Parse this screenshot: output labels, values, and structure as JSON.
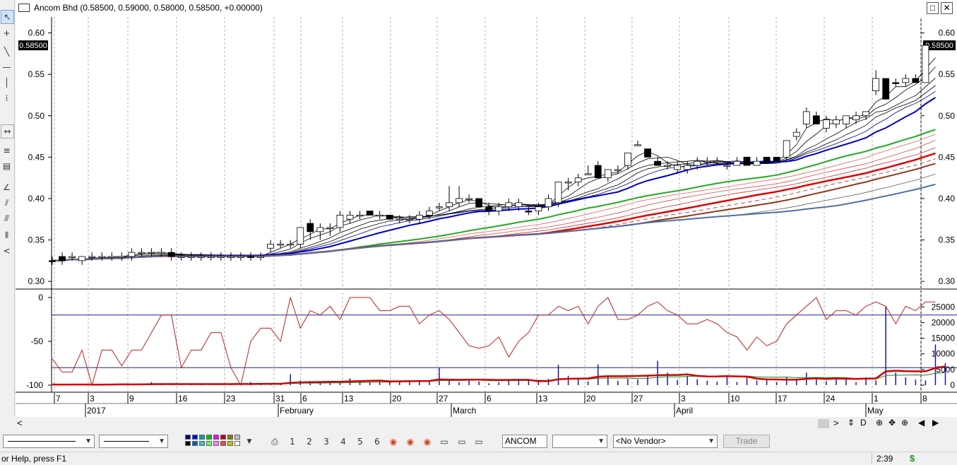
{
  "window": {
    "title": "Ancom Bhd (0.58500, 0.59000, 0.58000, 0.58500, +0.00000)",
    "restore_glyph": "□",
    "close_glyph": "✕"
  },
  "price_panel": {
    "y_ticks": [
      "0.60",
      "0.55",
      "0.50",
      "0.45",
      "0.40",
      "0.35",
      "0.30"
    ],
    "last_price_label": "0.58500"
  },
  "indicator_panel": {
    "left_ticks": [
      "0",
      "-50",
      "-100"
    ],
    "right_ticks": [
      "25000",
      "20000",
      "15000",
      "10000",
      "5000",
      "0"
    ]
  },
  "x_axis": {
    "day_labels": [
      "7",
      "3",
      "9",
      "16",
      "23",
      "31",
      "6",
      "13",
      "20",
      "27",
      "6",
      "13",
      "20",
      "27",
      "3",
      "10",
      "17",
      "24",
      "1",
      "8"
    ],
    "month_labels": [
      "2017",
      "February",
      "March",
      "April",
      "May"
    ]
  },
  "chart_data": {
    "type": "candlestick",
    "title": "Ancom Bhd (0.58500, 0.59000, 0.58000, 0.58500, +0.00000)",
    "price_ylim": [
      0.295,
      0.615
    ],
    "last_price": 0.585,
    "candles": [
      {
        "o": 0.325,
        "h": 0.33,
        "l": 0.32,
        "c": 0.325,
        "filled": true
      },
      {
        "o": 0.33,
        "h": 0.335,
        "l": 0.32,
        "c": 0.325,
        "filled": true
      },
      {
        "o": 0.33,
        "h": 0.335,
        "l": 0.325,
        "c": 0.33,
        "filled": false
      },
      {
        "o": 0.33,
        "h": 0.33,
        "l": 0.32,
        "c": 0.325,
        "filled": false
      },
      {
        "o": 0.33,
        "h": 0.335,
        "l": 0.325,
        "c": 0.33,
        "filled": false
      },
      {
        "o": 0.33,
        "h": 0.335,
        "l": 0.325,
        "c": 0.33,
        "filled": false
      },
      {
        "o": 0.33,
        "h": 0.335,
        "l": 0.325,
        "c": 0.33,
        "filled": false
      },
      {
        "o": 0.33,
        "h": 0.335,
        "l": 0.325,
        "c": 0.33,
        "filled": false
      },
      {
        "o": 0.33,
        "h": 0.34,
        "l": 0.325,
        "c": 0.335,
        "filled": false
      },
      {
        "o": 0.335,
        "h": 0.34,
        "l": 0.33,
        "c": 0.335,
        "filled": false
      },
      {
        "o": 0.335,
        "h": 0.34,
        "l": 0.33,
        "c": 0.335,
        "filled": false
      },
      {
        "o": 0.335,
        "h": 0.34,
        "l": 0.33,
        "c": 0.335,
        "filled": false
      },
      {
        "o": 0.335,
        "h": 0.34,
        "l": 0.325,
        "c": 0.33,
        "filled": true
      },
      {
        "o": 0.33,
        "h": 0.335,
        "l": 0.325,
        "c": 0.33,
        "filled": false
      },
      {
        "o": 0.33,
        "h": 0.335,
        "l": 0.325,
        "c": 0.33,
        "filled": false
      },
      {
        "o": 0.33,
        "h": 0.335,
        "l": 0.325,
        "c": 0.33,
        "filled": false
      },
      {
        "o": 0.33,
        "h": 0.335,
        "l": 0.325,
        "c": 0.33,
        "filled": false
      },
      {
        "o": 0.33,
        "h": 0.335,
        "l": 0.325,
        "c": 0.33,
        "filled": false
      },
      {
        "o": 0.33,
        "h": 0.335,
        "l": 0.325,
        "c": 0.33,
        "filled": false
      },
      {
        "o": 0.33,
        "h": 0.335,
        "l": 0.325,
        "c": 0.33,
        "filled": false
      },
      {
        "o": 0.33,
        "h": 0.335,
        "l": 0.325,
        "c": 0.33,
        "filled": true
      },
      {
        "o": 0.33,
        "h": 0.335,
        "l": 0.325,
        "c": 0.33,
        "filled": false
      },
      {
        "o": 0.34,
        "h": 0.35,
        "l": 0.335,
        "c": 0.345,
        "filled": false
      },
      {
        "o": 0.345,
        "h": 0.35,
        "l": 0.34,
        "c": 0.345,
        "filled": false
      },
      {
        "o": 0.345,
        "h": 0.35,
        "l": 0.34,
        "c": 0.345,
        "filled": false
      },
      {
        "o": 0.345,
        "h": 0.365,
        "l": 0.34,
        "c": 0.365,
        "filled": false
      },
      {
        "o": 0.37,
        "h": 0.375,
        "l": 0.35,
        "c": 0.36,
        "filled": true
      },
      {
        "o": 0.36,
        "h": 0.37,
        "l": 0.35,
        "c": 0.365,
        "filled": false
      },
      {
        "o": 0.365,
        "h": 0.37,
        "l": 0.355,
        "c": 0.365,
        "filled": false
      },
      {
        "o": 0.365,
        "h": 0.385,
        "l": 0.36,
        "c": 0.38,
        "filled": false
      },
      {
        "o": 0.375,
        "h": 0.385,
        "l": 0.37,
        "c": 0.38,
        "filled": false
      },
      {
        "o": 0.38,
        "h": 0.385,
        "l": 0.375,
        "c": 0.38,
        "filled": false
      },
      {
        "o": 0.385,
        "h": 0.385,
        "l": 0.38,
        "c": 0.38,
        "filled": true
      },
      {
        "o": 0.38,
        "h": 0.385,
        "l": 0.375,
        "c": 0.38,
        "filled": false
      },
      {
        "o": 0.38,
        "h": 0.38,
        "l": 0.375,
        "c": 0.375,
        "filled": true
      },
      {
        "o": 0.375,
        "h": 0.38,
        "l": 0.37,
        "c": 0.375,
        "filled": false
      },
      {
        "o": 0.375,
        "h": 0.38,
        "l": 0.37,
        "c": 0.375,
        "filled": false
      },
      {
        "o": 0.375,
        "h": 0.385,
        "l": 0.37,
        "c": 0.38,
        "filled": false
      },
      {
        "o": 0.38,
        "h": 0.39,
        "l": 0.375,
        "c": 0.385,
        "filled": false
      },
      {
        "o": 0.39,
        "h": 0.395,
        "l": 0.385,
        "c": 0.39,
        "filled": false
      },
      {
        "o": 0.39,
        "h": 0.415,
        "l": 0.385,
        "c": 0.395,
        "filled": false
      },
      {
        "o": 0.395,
        "h": 0.415,
        "l": 0.39,
        "c": 0.4,
        "filled": false
      },
      {
        "o": 0.4,
        "h": 0.405,
        "l": 0.395,
        "c": 0.4,
        "filled": false
      },
      {
        "o": 0.4,
        "h": 0.4,
        "l": 0.39,
        "c": 0.39,
        "filled": true
      },
      {
        "o": 0.39,
        "h": 0.395,
        "l": 0.38,
        "c": 0.385,
        "filled": true
      },
      {
        "o": 0.385,
        "h": 0.395,
        "l": 0.38,
        "c": 0.39,
        "filled": false
      },
      {
        "o": 0.39,
        "h": 0.4,
        "l": 0.385,
        "c": 0.395,
        "filled": false
      },
      {
        "o": 0.39,
        "h": 0.4,
        "l": 0.385,
        "c": 0.395,
        "filled": false
      },
      {
        "o": 0.385,
        "h": 0.39,
        "l": 0.38,
        "c": 0.385,
        "filled": true
      },
      {
        "o": 0.385,
        "h": 0.395,
        "l": 0.38,
        "c": 0.39,
        "filled": false
      },
      {
        "o": 0.39,
        "h": 0.405,
        "l": 0.385,
        "c": 0.4,
        "filled": false
      },
      {
        "o": 0.395,
        "h": 0.42,
        "l": 0.39,
        "c": 0.42,
        "filled": false
      },
      {
        "o": 0.42,
        "h": 0.425,
        "l": 0.41,
        "c": 0.42,
        "filled": false
      },
      {
        "o": 0.42,
        "h": 0.43,
        "l": 0.415,
        "c": 0.425,
        "filled": false
      },
      {
        "o": 0.43,
        "h": 0.44,
        "l": 0.43,
        "c": 0.43,
        "filled": false
      },
      {
        "o": 0.44,
        "h": 0.445,
        "l": 0.425,
        "c": 0.425,
        "filled": true
      },
      {
        "o": 0.425,
        "h": 0.435,
        "l": 0.42,
        "c": 0.435,
        "filled": false
      },
      {
        "o": 0.435,
        "h": 0.44,
        "l": 0.43,
        "c": 0.435,
        "filled": false
      },
      {
        "o": 0.44,
        "h": 0.455,
        "l": 0.435,
        "c": 0.455,
        "filled": false
      },
      {
        "o": 0.465,
        "h": 0.47,
        "l": 0.465,
        "c": 0.465,
        "filled": false
      },
      {
        "o": 0.46,
        "h": 0.46,
        "l": 0.45,
        "c": 0.45,
        "filled": true
      },
      {
        "o": 0.445,
        "h": 0.45,
        "l": 0.44,
        "c": 0.44,
        "filled": true
      },
      {
        "o": 0.44,
        "h": 0.445,
        "l": 0.435,
        "c": 0.44,
        "filled": false
      },
      {
        "o": 0.44,
        "h": 0.445,
        "l": 0.43,
        "c": 0.435,
        "filled": false
      },
      {
        "o": 0.435,
        "h": 0.445,
        "l": 0.43,
        "c": 0.44,
        "filled": false
      },
      {
        "o": 0.44,
        "h": 0.45,
        "l": 0.435,
        "c": 0.445,
        "filled": false
      },
      {
        "o": 0.445,
        "h": 0.45,
        "l": 0.44,
        "c": 0.445,
        "filled": false
      },
      {
        "o": 0.445,
        "h": 0.45,
        "l": 0.44,
        "c": 0.445,
        "filled": false
      },
      {
        "o": 0.44,
        "h": 0.445,
        "l": 0.435,
        "c": 0.44,
        "filled": false
      },
      {
        "o": 0.44,
        "h": 0.45,
        "l": 0.44,
        "c": 0.445,
        "filled": false
      },
      {
        "o": 0.45,
        "h": 0.45,
        "l": 0.44,
        "c": 0.44,
        "filled": true
      },
      {
        "o": 0.44,
        "h": 0.45,
        "l": 0.44,
        "c": 0.445,
        "filled": false
      },
      {
        "o": 0.45,
        "h": 0.45,
        "l": 0.445,
        "c": 0.445,
        "filled": true
      },
      {
        "o": 0.45,
        "h": 0.45,
        "l": 0.445,
        "c": 0.445,
        "filled": true
      },
      {
        "o": 0.45,
        "h": 0.47,
        "l": 0.445,
        "c": 0.47,
        "filled": false
      },
      {
        "o": 0.475,
        "h": 0.485,
        "l": 0.47,
        "c": 0.48,
        "filled": false
      },
      {
        "o": 0.49,
        "h": 0.51,
        "l": 0.485,
        "c": 0.505,
        "filled": false
      },
      {
        "o": 0.5,
        "h": 0.505,
        "l": 0.49,
        "c": 0.49,
        "filled": true
      },
      {
        "o": 0.485,
        "h": 0.5,
        "l": 0.48,
        "c": 0.495,
        "filled": false
      },
      {
        "o": 0.49,
        "h": 0.5,
        "l": 0.485,
        "c": 0.495,
        "filled": false
      },
      {
        "o": 0.49,
        "h": 0.5,
        "l": 0.485,
        "c": 0.5,
        "filled": false
      },
      {
        "o": 0.495,
        "h": 0.505,
        "l": 0.49,
        "c": 0.5,
        "filled": false
      },
      {
        "o": 0.5,
        "h": 0.505,
        "l": 0.495,
        "c": 0.505,
        "filled": false
      },
      {
        "o": 0.53,
        "h": 0.555,
        "l": 0.525,
        "c": 0.545,
        "filled": false
      },
      {
        "o": 0.545,
        "h": 0.545,
        "l": 0.52,
        "c": 0.52,
        "filled": true
      },
      {
        "o": 0.54,
        "h": 0.545,
        "l": 0.535,
        "c": 0.54,
        "filled": true
      },
      {
        "o": 0.54,
        "h": 0.55,
        "l": 0.535,
        "c": 0.545,
        "filled": false
      },
      {
        "o": 0.545,
        "h": 0.55,
        "l": 0.54,
        "c": 0.54,
        "filled": true
      },
      {
        "o": 0.54,
        "h": 0.59,
        "l": 0.54,
        "c": 0.585,
        "filled": false
      },
      {
        "o": 0.585,
        "h": 0.59,
        "l": 0.58,
        "c": 0.585,
        "filled": false
      }
    ],
    "oscillator": {
      "ylim": [
        -100,
        0
      ],
      "values": [
        -70,
        -85,
        -85,
        -60,
        -100,
        -60,
        -60,
        -78,
        -60,
        -60,
        -40,
        -20,
        -20,
        -80,
        -60,
        -60,
        -40,
        -40,
        -80,
        -100,
        -50,
        -35,
        -35,
        -50,
        0,
        -35,
        -15,
        -20,
        -10,
        -25,
        0,
        0,
        0,
        -15,
        -15,
        -10,
        -10,
        -30,
        -20,
        -15,
        -25,
        -40,
        -55,
        -58,
        -55,
        -45,
        -68,
        -50,
        -40,
        -20,
        -20,
        -10,
        -15,
        -10,
        -30,
        -10,
        0,
        -25,
        -25,
        -20,
        -10,
        -5,
        -15,
        -20,
        -30,
        -30,
        -25,
        -30,
        -40,
        -45,
        -60,
        -45,
        -55,
        -50,
        -30,
        -20,
        -10,
        0,
        -25,
        -15,
        -15,
        -20,
        -10,
        -5,
        -10,
        -30,
        -10,
        -15,
        -5,
        -5
      ]
    },
    "volume": {
      "ylim": [
        0,
        28000
      ],
      "values": [
        200,
        100,
        300,
        200,
        100,
        200,
        400,
        400,
        200,
        300,
        1000,
        300,
        200,
        200,
        300,
        200,
        400,
        200,
        400,
        500,
        1000,
        600,
        400,
        300,
        3500,
        1500,
        1000,
        800,
        1200,
        700,
        2200,
        1600,
        900,
        1300,
        1100,
        1300,
        1600,
        1200,
        1500,
        5600,
        1500,
        1000,
        1400,
        1200,
        600,
        900,
        1800,
        1400,
        1500,
        1400,
        2000,
        6500,
        3000,
        1800,
        1200,
        6600,
        3000,
        1400,
        2000,
        1800,
        3000,
        7800,
        4000,
        1700,
        3000,
        1900,
        1400,
        1100,
        3000,
        1000,
        2500,
        1500,
        1600,
        1000,
        2500,
        2000,
        4000,
        2300,
        1300,
        2500,
        1900,
        1000,
        2500,
        1500,
        25000,
        4000,
        2500,
        1800,
        1500,
        13000,
        7000
      ]
    }
  },
  "bottom_scroll": {
    "left_arrow": "<",
    "right_arrow": ">",
    "controls": [
      "⇕",
      "D",
      "⊕",
      "✥",
      "⊕",
      "◀",
      "▶"
    ]
  },
  "toolbar": {
    "symbol_value": "ANCOM",
    "period_value": "",
    "vendor_value": "<No Vendor>",
    "trade_label": "Trade",
    "swatch_colors": [
      "#000080",
      "#0000ff",
      "#00a0a0",
      "#00c000",
      "#ff00ff",
      "#c00000",
      "#808000",
      "#c0c0c0",
      "#000000",
      "#0060c0",
      "#40c0c0",
      "#60ff60",
      "#ff80ff",
      "#ff4040",
      "#c0c000",
      "#ffffff"
    ],
    "icon_labels": [
      "1",
      "2",
      "3",
      "4",
      "5",
      "6"
    ]
  },
  "statusbar": {
    "help_text": "or Help, press F1",
    "time": "2:39",
    "dollar_glyph": "$"
  }
}
